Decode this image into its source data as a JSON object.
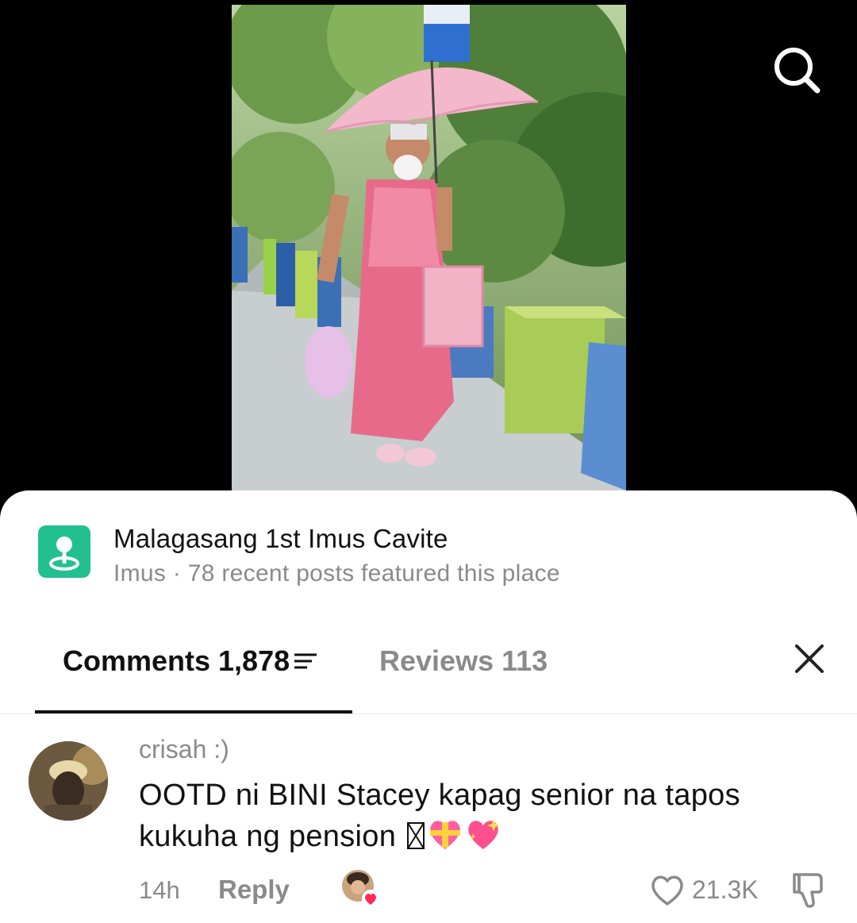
{
  "place": {
    "icon": "map-pin-icon",
    "icon_color": "#22c08f",
    "title": "Malagasang 1st Imus Cavite",
    "subtitle": "Imus · 78 recent posts featured this place"
  },
  "tabs": {
    "comments_label": "Comments 1,878",
    "reviews_label": "Reviews 113",
    "active": "comments"
  },
  "comment": {
    "username": "crisah :)",
    "text": "OOTD ni BINI Stacey kapag senior na tapos kukuha ng pension ",
    "time": "14h",
    "reply_label": "Reply",
    "like_count": "21.3K",
    "emojis": [
      "missing-glyph",
      "heart-with-ribbon-icon",
      "sparkling-heart-icon"
    ]
  },
  "icons": {
    "search": "search-icon",
    "close": "close-icon",
    "sort": "sort-icon",
    "like": "heart-outline-icon",
    "dislike": "thumbs-down-icon"
  }
}
